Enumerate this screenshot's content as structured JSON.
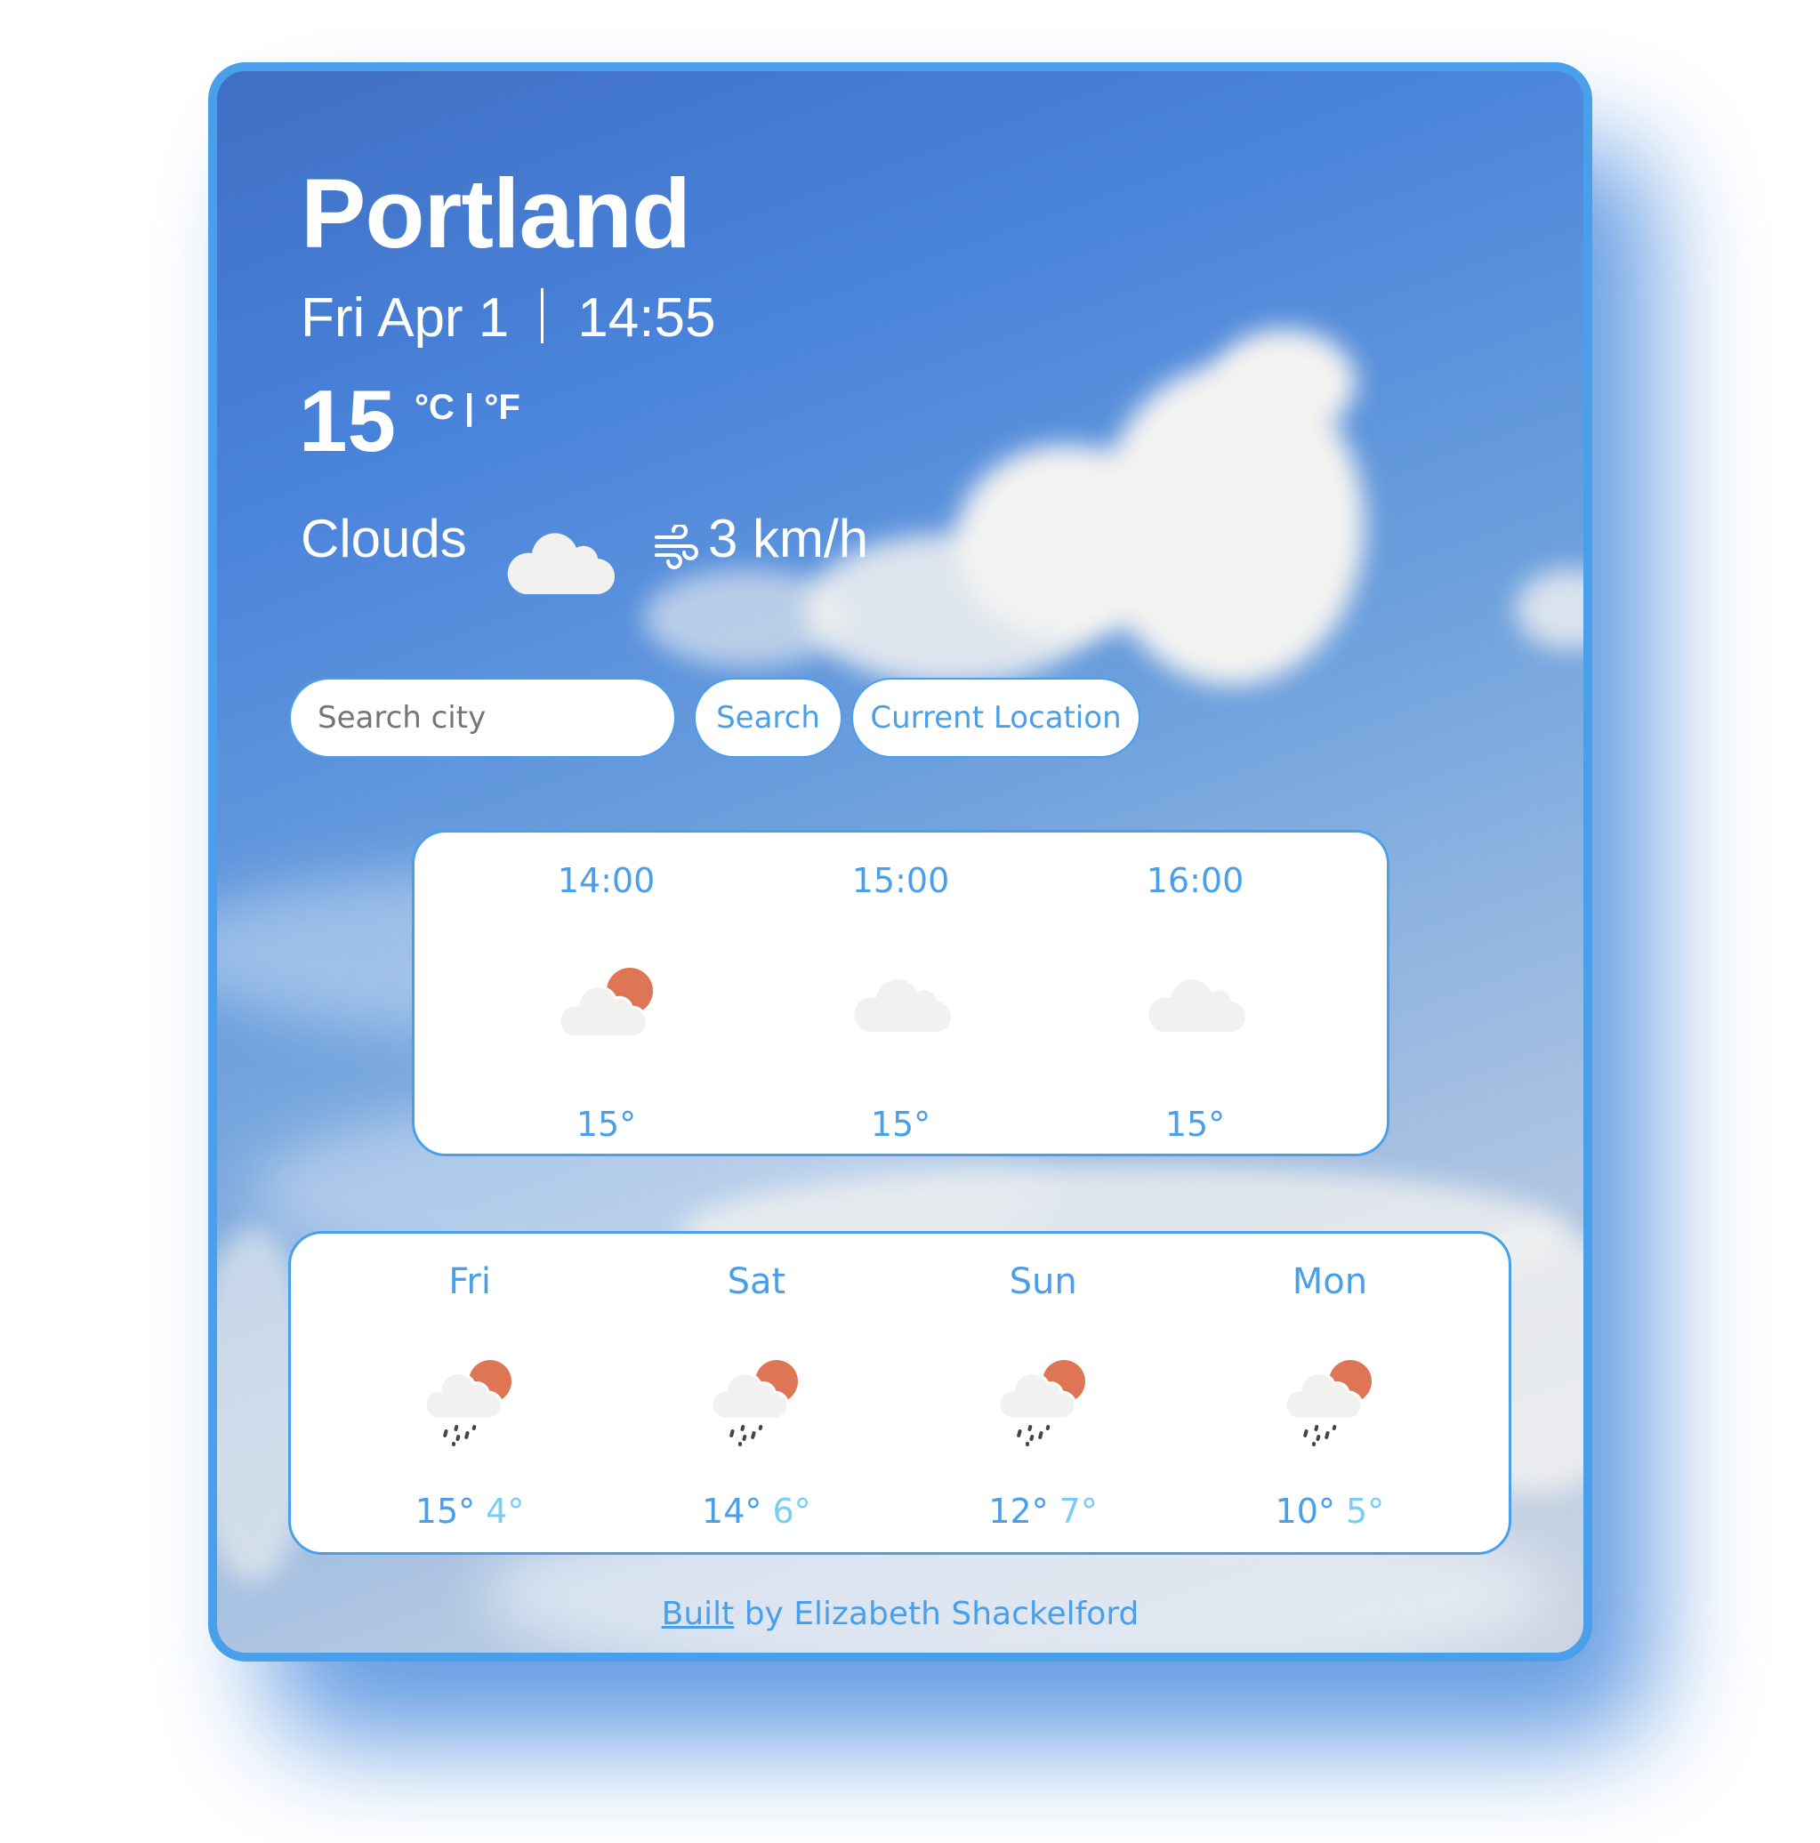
{
  "weather": {
    "city": "Portland",
    "date": "Fri Apr 1",
    "time": "14:55",
    "temperature": "15",
    "unit_celsius": "°C",
    "unit_separator": "|",
    "unit_fahrenheit": "°F",
    "description": "Clouds",
    "description_icon": "cloud-icon",
    "wind_icon": "wind-icon",
    "wind": "3 km/h"
  },
  "search": {
    "placeholder": "Search city",
    "value": "",
    "search_label": "Search",
    "location_label": "Current Location"
  },
  "hourly": [
    {
      "time": "14:00",
      "icon": "partly-cloudy-icon",
      "temp": "15°"
    },
    {
      "time": "15:00",
      "icon": "cloud-icon",
      "temp": "15°"
    },
    {
      "time": "16:00",
      "icon": "cloud-icon",
      "temp": "15°"
    }
  ],
  "daily": [
    {
      "day": "Fri",
      "icon": "sun-cloud-rain-icon",
      "max": "15°",
      "min": "4°"
    },
    {
      "day": "Sat",
      "icon": "sun-cloud-rain-icon",
      "max": "14°",
      "min": "6°"
    },
    {
      "day": "Sun",
      "icon": "sun-cloud-rain-icon",
      "max": "12°",
      "min": "7°"
    },
    {
      "day": "Mon",
      "icon": "sun-cloud-rain-icon",
      "max": "10°",
      "min": "5°"
    }
  ],
  "footer": {
    "link_label": "Built",
    "text": " by Elizabeth Shackelford"
  },
  "colors": {
    "accent": "#4A9FEB",
    "min_temp": "#7ACDF5",
    "sun": "#DE7555",
    "cloud": "#F1F1F0"
  }
}
